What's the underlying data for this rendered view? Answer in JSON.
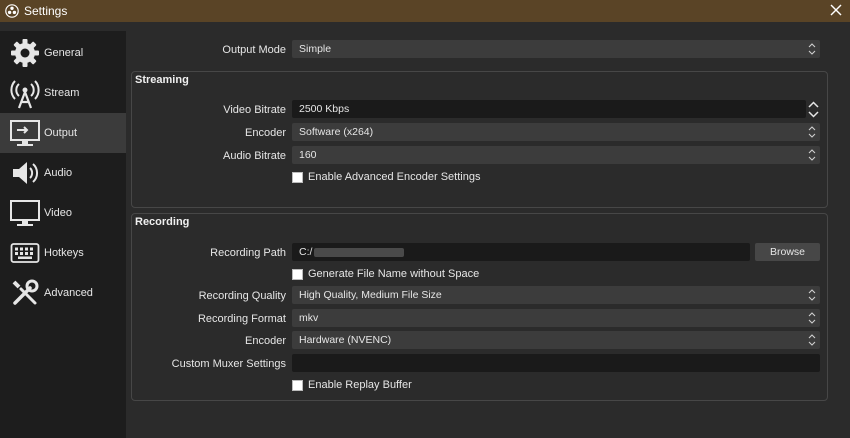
{
  "window": {
    "title": "Settings",
    "app_icon": "obs-icon",
    "close_icon": "close-icon"
  },
  "sidebar": {
    "items": [
      {
        "label": "General",
        "icon": "gear-icon"
      },
      {
        "label": "Stream",
        "icon": "broadcast-icon"
      },
      {
        "label": "Output",
        "icon": "output-monitor-icon",
        "active": true
      },
      {
        "label": "Audio",
        "icon": "speaker-icon"
      },
      {
        "label": "Video",
        "icon": "monitor-icon"
      },
      {
        "label": "Hotkeys",
        "icon": "keyboard-icon"
      },
      {
        "label": "Advanced",
        "icon": "wrench-screwdriver-icon"
      }
    ]
  },
  "output_mode": {
    "label": "Output Mode",
    "value": "Simple"
  },
  "streaming": {
    "title": "Streaming",
    "video_bitrate": {
      "label": "Video Bitrate",
      "value": "2500 Kbps"
    },
    "encoder": {
      "label": "Encoder",
      "value": "Software (x264)"
    },
    "audio_bitrate": {
      "label": "Audio Bitrate",
      "value": "160"
    },
    "advanced_encoder": {
      "label": "Enable Advanced Encoder Settings",
      "checked": false
    }
  },
  "recording": {
    "title": "Recording",
    "path": {
      "label": "Recording Path",
      "value": "C:/"
    },
    "browse_label": "Browse",
    "no_space": {
      "label": "Generate File Name without Space",
      "checked": false
    },
    "quality": {
      "label": "Recording Quality",
      "value": "High Quality, Medium File Size"
    },
    "format": {
      "label": "Recording Format",
      "value": "mkv"
    },
    "encoder": {
      "label": "Encoder",
      "value": "Hardware (NVENC)"
    },
    "muxer": {
      "label": "Custom Muxer Settings",
      "value": ""
    },
    "replay": {
      "label": "Enable Replay Buffer",
      "checked": false
    }
  },
  "colors": {
    "titlebar": "#5a4426",
    "sidebar": "#1d1d1d",
    "panel": "#2b2b2b",
    "field": "#3c3c3c",
    "active_item": "#3b3b3b"
  }
}
